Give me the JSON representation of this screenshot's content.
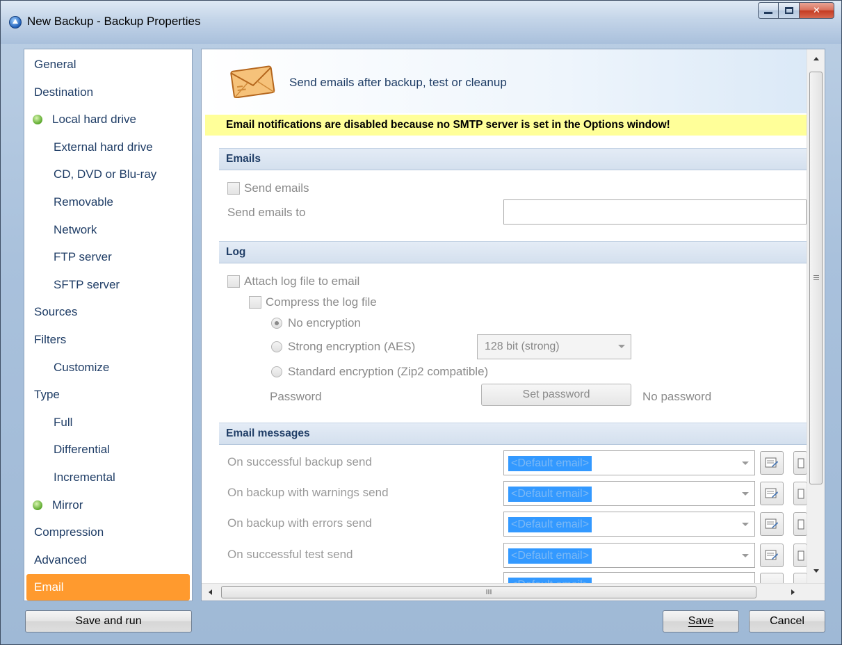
{
  "window": {
    "title": "New Backup - Backup Properties"
  },
  "nav": {
    "items": [
      {
        "label": "General",
        "level": 0,
        "status": ""
      },
      {
        "label": "Destination",
        "level": 0,
        "status": ""
      },
      {
        "label": "Local hard drive",
        "level": 1,
        "status": "green"
      },
      {
        "label": "External hard drive",
        "level": 1,
        "status": ""
      },
      {
        "label": "CD, DVD or Blu-ray",
        "level": 1,
        "status": ""
      },
      {
        "label": "Removable",
        "level": 1,
        "status": ""
      },
      {
        "label": "Network",
        "level": 1,
        "status": ""
      },
      {
        "label": "FTP server",
        "level": 1,
        "status": ""
      },
      {
        "label": "SFTP server",
        "level": 1,
        "status": ""
      },
      {
        "label": "Sources",
        "level": 0,
        "status": ""
      },
      {
        "label": "Filters",
        "level": 0,
        "status": ""
      },
      {
        "label": "Customize",
        "level": 1,
        "status": ""
      },
      {
        "label": "Type",
        "level": 0,
        "status": ""
      },
      {
        "label": "Full",
        "level": 1,
        "status": ""
      },
      {
        "label": "Differential",
        "level": 1,
        "status": ""
      },
      {
        "label": "Incremental",
        "level": 1,
        "status": ""
      },
      {
        "label": "Mirror",
        "level": 1,
        "status": "green"
      },
      {
        "label": "Compression",
        "level": 0,
        "status": ""
      },
      {
        "label": "Advanced",
        "level": 0,
        "status": ""
      },
      {
        "label": "Email",
        "level": 0,
        "status": "active"
      }
    ]
  },
  "header": {
    "title": "Send emails after backup, test or cleanup",
    "icon": "envelope-icon"
  },
  "warning": "Email notifications are disabled because no SMTP server is set in the Options window!",
  "emails_section": {
    "title": "Emails",
    "send_emails_label": "Send emails",
    "send_emails_checked": false,
    "send_to_label": "Send emails to",
    "send_to_value": ""
  },
  "log_section": {
    "title": "Log",
    "attach_label": "Attach log file to email",
    "attach_checked": false,
    "compress_label": "Compress the log file",
    "compress_checked": false,
    "no_encryption_label": "No encryption",
    "strong_encryption_label": "Strong encryption (AES)",
    "strong_bits_value": "128 bit (strong)",
    "standard_encryption_label": "Standard encryption (Zip2 compatible)",
    "selected_encryption": "No encryption",
    "password_label": "Password",
    "set_password_label": "Set password",
    "password_status": "No password"
  },
  "messages_section": {
    "title": "Email messages",
    "rows": [
      {
        "label": "On successful backup send",
        "value": "<Default email>"
      },
      {
        "label": "On backup with warnings send",
        "value": "<Default email>"
      },
      {
        "label": "On backup with errors send",
        "value": "<Default email>"
      },
      {
        "label": "On successful test send",
        "value": "<Default email>"
      }
    ],
    "partial_row_value": "<Default email>"
  },
  "scrollbar": {
    "h_grip": "III"
  },
  "buttons": {
    "save_and_run": "Save and run",
    "save": "Save",
    "cancel": "Cancel"
  },
  "colors": {
    "active_nav": "#ff9a2e",
    "warning_bg": "#ffff99",
    "selection": "#3399ff"
  }
}
